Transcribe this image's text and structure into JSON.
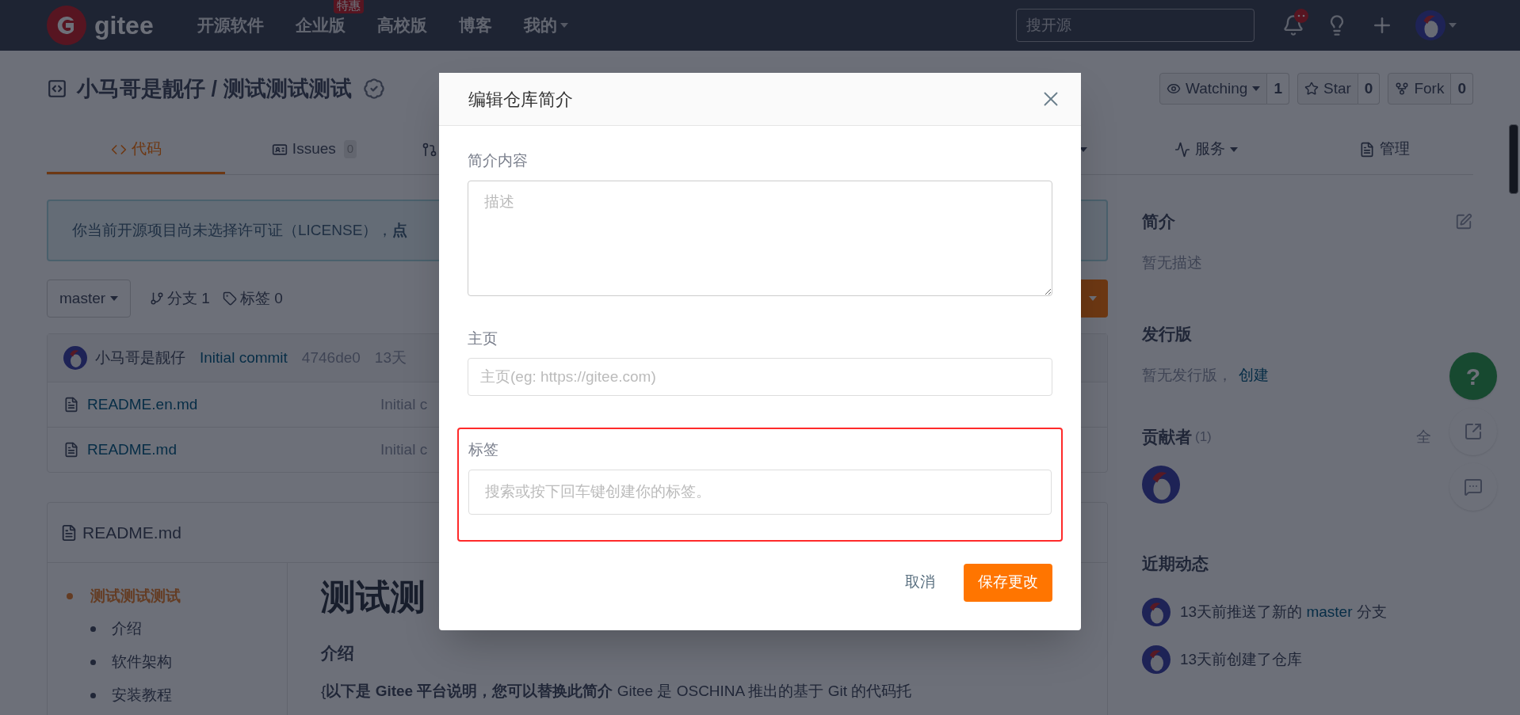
{
  "nav": {
    "logo_text": "gitee",
    "items": [
      {
        "label": "开源软件",
        "dropdown": false
      },
      {
        "label": "企业版",
        "badge": "特惠",
        "dropdown": false
      },
      {
        "label": "高校版",
        "dropdown": false
      },
      {
        "label": "博客",
        "dropdown": false
      },
      {
        "label": "我的",
        "dropdown": true
      }
    ],
    "search": {
      "placeholder": "搜开源"
    }
  },
  "repo": {
    "owner": "小马哥是靓仔",
    "separator": "/",
    "name": "测试测试测试",
    "actions": [
      {
        "label": "Watching",
        "dropdown": true,
        "count": "1"
      },
      {
        "label": "Star",
        "dropdown": false,
        "count": "0"
      },
      {
        "label": "Fork",
        "dropdown": false,
        "count": "0"
      }
    ]
  },
  "tabs": [
    {
      "kind": "full",
      "label": "代码",
      "dropdown": false,
      "selected": true
    },
    {
      "kind": "full",
      "label": "Issues",
      "count": "0",
      "dropdown": false,
      "selected": false
    },
    {
      "kind": "icon-only",
      "selected": false
    },
    {
      "kind": "caret-only",
      "selected": false
    },
    {
      "kind": "full",
      "label": "服务",
      "dropdown": true,
      "selected": false
    },
    {
      "kind": "full",
      "label": "管理",
      "dropdown": false,
      "selected": false
    }
  ],
  "license_notice": "你当前开源项目尚未选择许可证（LICENSE），**点**",
  "branch": {
    "name": "master",
    "branches": "分支 1",
    "tags": "标签 0"
  },
  "commit": {
    "author": "小马哥是靓仔",
    "message": "Initial commit",
    "hash": "4746de0",
    "time": "13天"
  },
  "files": [
    {
      "name": "README.en.md",
      "commit": "Initial c"
    },
    {
      "name": "README.md",
      "commit": "Initial c"
    }
  ],
  "readme": {
    "file": "README.md",
    "toc": [
      {
        "label": "测试测试测试",
        "selected": true,
        "children": [
          {
            "label": "介绍",
            "selected": false
          },
          {
            "label": "软件架构",
            "selected": false
          },
          {
            "label": "安装教程",
            "selected": false
          }
        ]
      }
    ],
    "title": "测试测",
    "heading": "介绍",
    "paragraph": "{**以下是 Gitee 平台说明，您可以替换此简介** Gitee 是 OSCHINA 推出的基于 Git 的代码托"
  },
  "sidebar": {
    "about": {
      "title": "简介",
      "text": "暂无描述"
    },
    "releases": {
      "title": "发行版",
      "text": "暂无发行版，",
      "link": "创建"
    },
    "contributors": {
      "title": "贡献者",
      "count": "(1)",
      "more": "全"
    },
    "activity": {
      "title": "近期动态",
      "items": [
        {
          "before": "13天前推送了新的",
          "link": "master",
          "after": "分支"
        },
        {
          "before": "13天前创建了仓库"
        }
      ]
    }
  },
  "float_help": "?",
  "modal": {
    "title": "编辑仓库简介",
    "fields": [
      {
        "kind": "textarea",
        "label": "简介内容",
        "placeholder": "描述",
        "highlighted": false
      },
      {
        "kind": "input",
        "label": "主页",
        "placeholder": "主页(eg: https://gitee.com)",
        "highlighted": false
      },
      {
        "kind": "input",
        "label": "标签",
        "placeholder": "搜索或按下回车键创建你的标签。",
        "highlighted": true
      }
    ],
    "buttons": [
      {
        "kind": "link",
        "label": "取消"
      },
      {
        "kind": "primary",
        "label": "保存更改"
      }
    ]
  }
}
